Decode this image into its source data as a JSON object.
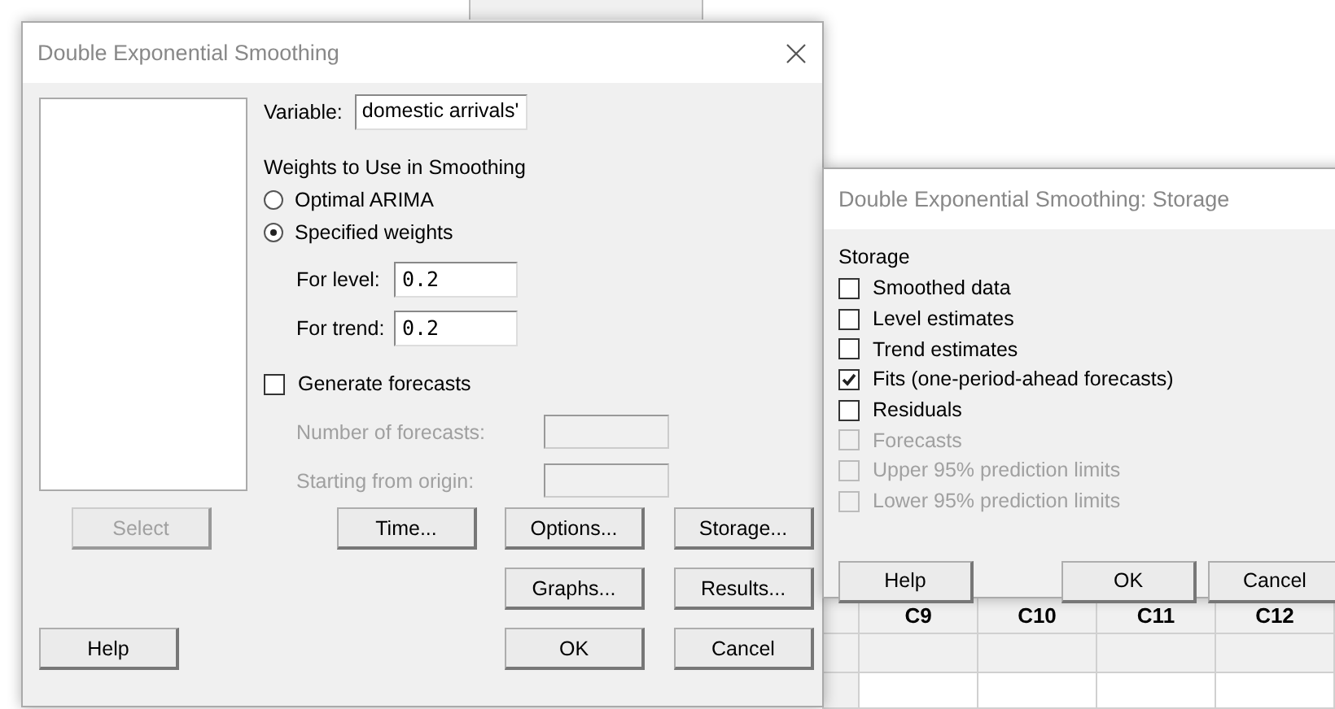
{
  "main_dialog": {
    "title": "Double Exponential Smoothing",
    "variable": {
      "label": "Variable:",
      "value": "domestic arrivals'"
    },
    "weights": {
      "heading": "Weights to Use in Smoothing",
      "options": [
        {
          "label": "Optimal ARIMA",
          "selected": false
        },
        {
          "label": "Specified weights",
          "selected": true
        }
      ],
      "fields": [
        {
          "label": "For level:",
          "value": "0.2"
        },
        {
          "label": "For trend:",
          "value": "0.2"
        }
      ]
    },
    "generate_forecasts": {
      "label": "Generate forecasts",
      "checked": false
    },
    "forecast_fields": [
      {
        "label": "Number of forecasts:",
        "disabled": true
      },
      {
        "label": "Starting from origin:",
        "disabled": true
      }
    ],
    "button_rows": [
      [
        {
          "label": "Select",
          "disabled": true
        },
        {
          "label": "Time...",
          "disabled": false
        },
        {
          "label": "Options...",
          "disabled": false
        },
        {
          "label": "Storage...",
          "disabled": false
        }
      ],
      [
        {
          "label": "Graphs...",
          "disabled": false
        },
        {
          "label": "Results...",
          "disabled": false
        }
      ],
      [
        {
          "label": "Help",
          "disabled": false
        },
        {
          "label": "OK",
          "disabled": false
        },
        {
          "label": "Cancel",
          "disabled": false
        }
      ]
    ]
  },
  "storage_dialog": {
    "title": "Double Exponential Smoothing: Storage",
    "heading": "Storage",
    "items": [
      {
        "label": "Smoothed data",
        "checked": false,
        "disabled": false
      },
      {
        "label": "Level estimates",
        "checked": false,
        "disabled": false
      },
      {
        "label": "Trend estimates",
        "checked": false,
        "disabled": false
      },
      {
        "label": "Fits (one-period-ahead forecasts)",
        "checked": true,
        "disabled": false
      },
      {
        "label": "Residuals",
        "checked": false,
        "disabled": false
      },
      {
        "label": "Forecasts",
        "checked": false,
        "disabled": true
      },
      {
        "label": "Upper 95% prediction limits",
        "checked": false,
        "disabled": true
      },
      {
        "label": "Lower 95% prediction limits",
        "checked": false,
        "disabled": true
      }
    ],
    "buttons": [
      "Help",
      "OK",
      "Cancel"
    ]
  },
  "worksheet": {
    "columns": [
      "C9",
      "C10",
      "C11",
      "C12"
    ]
  }
}
